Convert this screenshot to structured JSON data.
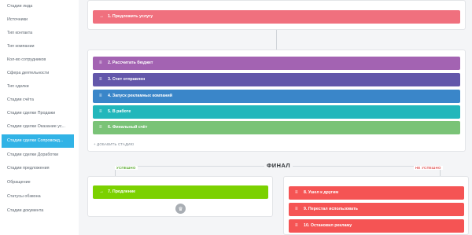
{
  "sidebar": {
    "items": [
      {
        "label": "Стадии лида"
      },
      {
        "label": "Источники"
      },
      {
        "label": "Тип контакта"
      },
      {
        "label": "Тип компании"
      },
      {
        "label": "Кол-во сотрудников"
      },
      {
        "label": "Сфера деятельности"
      },
      {
        "label": "Тип сделки"
      },
      {
        "label": "Стадии счёта"
      },
      {
        "label": "Стадии сделки Продажи"
      },
      {
        "label": "Стадии сделки Оказание ус..."
      },
      {
        "label": "Стадии сделки Сопровожд..."
      },
      {
        "label": "Стадии сделки Доработки"
      },
      {
        "label": "Стадии предложения"
      },
      {
        "label": "Обращение"
      },
      {
        "label": "Статусы обзвона"
      },
      {
        "label": "Стадии документа"
      }
    ],
    "active_index": 10
  },
  "start_stage": {
    "label": "1. Предложить услугу",
    "color": "#f0707e"
  },
  "stages": [
    {
      "label": "2. Рассчитать бюджет",
      "color": "#a363b2"
    },
    {
      "label": "3. Счет отправлен",
      "color": "#6357aa"
    },
    {
      "label": "4. Запуск рекламных компаний",
      "color": "#3a86c9"
    },
    {
      "label": "5. В работе",
      "color": "#22b7bb"
    },
    {
      "label": "6. Финальный счёт",
      "color": "#7ac377"
    }
  ],
  "add_stage_label": "+ ДОБАВИТЬ СТАДИЮ",
  "final": {
    "title": "ФИНАЛ",
    "success_tag": "УСПЕШНО",
    "success_color": "#57a82c",
    "fail_tag": "НЕ УСПЕШНО",
    "fail_color": "#e05555",
    "success_stages": [
      {
        "label": "7. Продление",
        "color": "#7bd100"
      }
    ],
    "fail_stages": [
      {
        "label": "8. Ушел к другим",
        "color": "#f55454"
      },
      {
        "label": "9. Перестал использовать",
        "color": "#f55454"
      },
      {
        "label": "10. Остановил рекламу",
        "color": "#f55454"
      }
    ]
  },
  "icons": {
    "arrow": "arrow-right-icon",
    "drag": "drag-handle-icon",
    "trophy": "trophy-icon"
  }
}
